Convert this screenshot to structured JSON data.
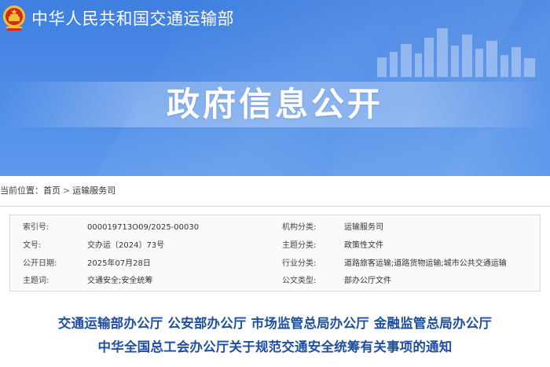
{
  "header": {
    "site_title": "中华人民共和国交通运输部",
    "banner_title": "政府信息公开"
  },
  "breadcrumb": {
    "prefix": "当前位置：",
    "home": "首页",
    "separator": ">",
    "current": "运输服务司"
  },
  "meta": {
    "rows": [
      {
        "label1": "索引号:",
        "value1": "000019713O09/2025-00030",
        "label2": "机构分类:",
        "value2": "运输服务司"
      },
      {
        "label1": "文号:",
        "value1": "交办运〔2024〕73号",
        "label2": "主题分类:",
        "value2": "政策性文件"
      },
      {
        "label1": "公开日期:",
        "value1": "2025年07月28日",
        "label2": "行业分类:",
        "value2": "道路旅客运输;道路货物运输;城市公共交通运输"
      },
      {
        "label1": "主题词:",
        "value1": "交通安全;安全统筹",
        "label2": "公文类型:",
        "value2": "部办公厅文件"
      }
    ]
  },
  "article": {
    "title_line1": "交通运输部办公厅 公安部办公厅 市场监管总局办公厅 金融监管总局办公厅",
    "title_line2": "中华全国总工会办公厅关于规范交通安全统筹有关事项的通知"
  },
  "colors": {
    "banner": "#4b8ae6",
    "headline": "#1f4fa0",
    "emblem_red": "#d42a1e",
    "emblem_gold": "#f2c230"
  }
}
